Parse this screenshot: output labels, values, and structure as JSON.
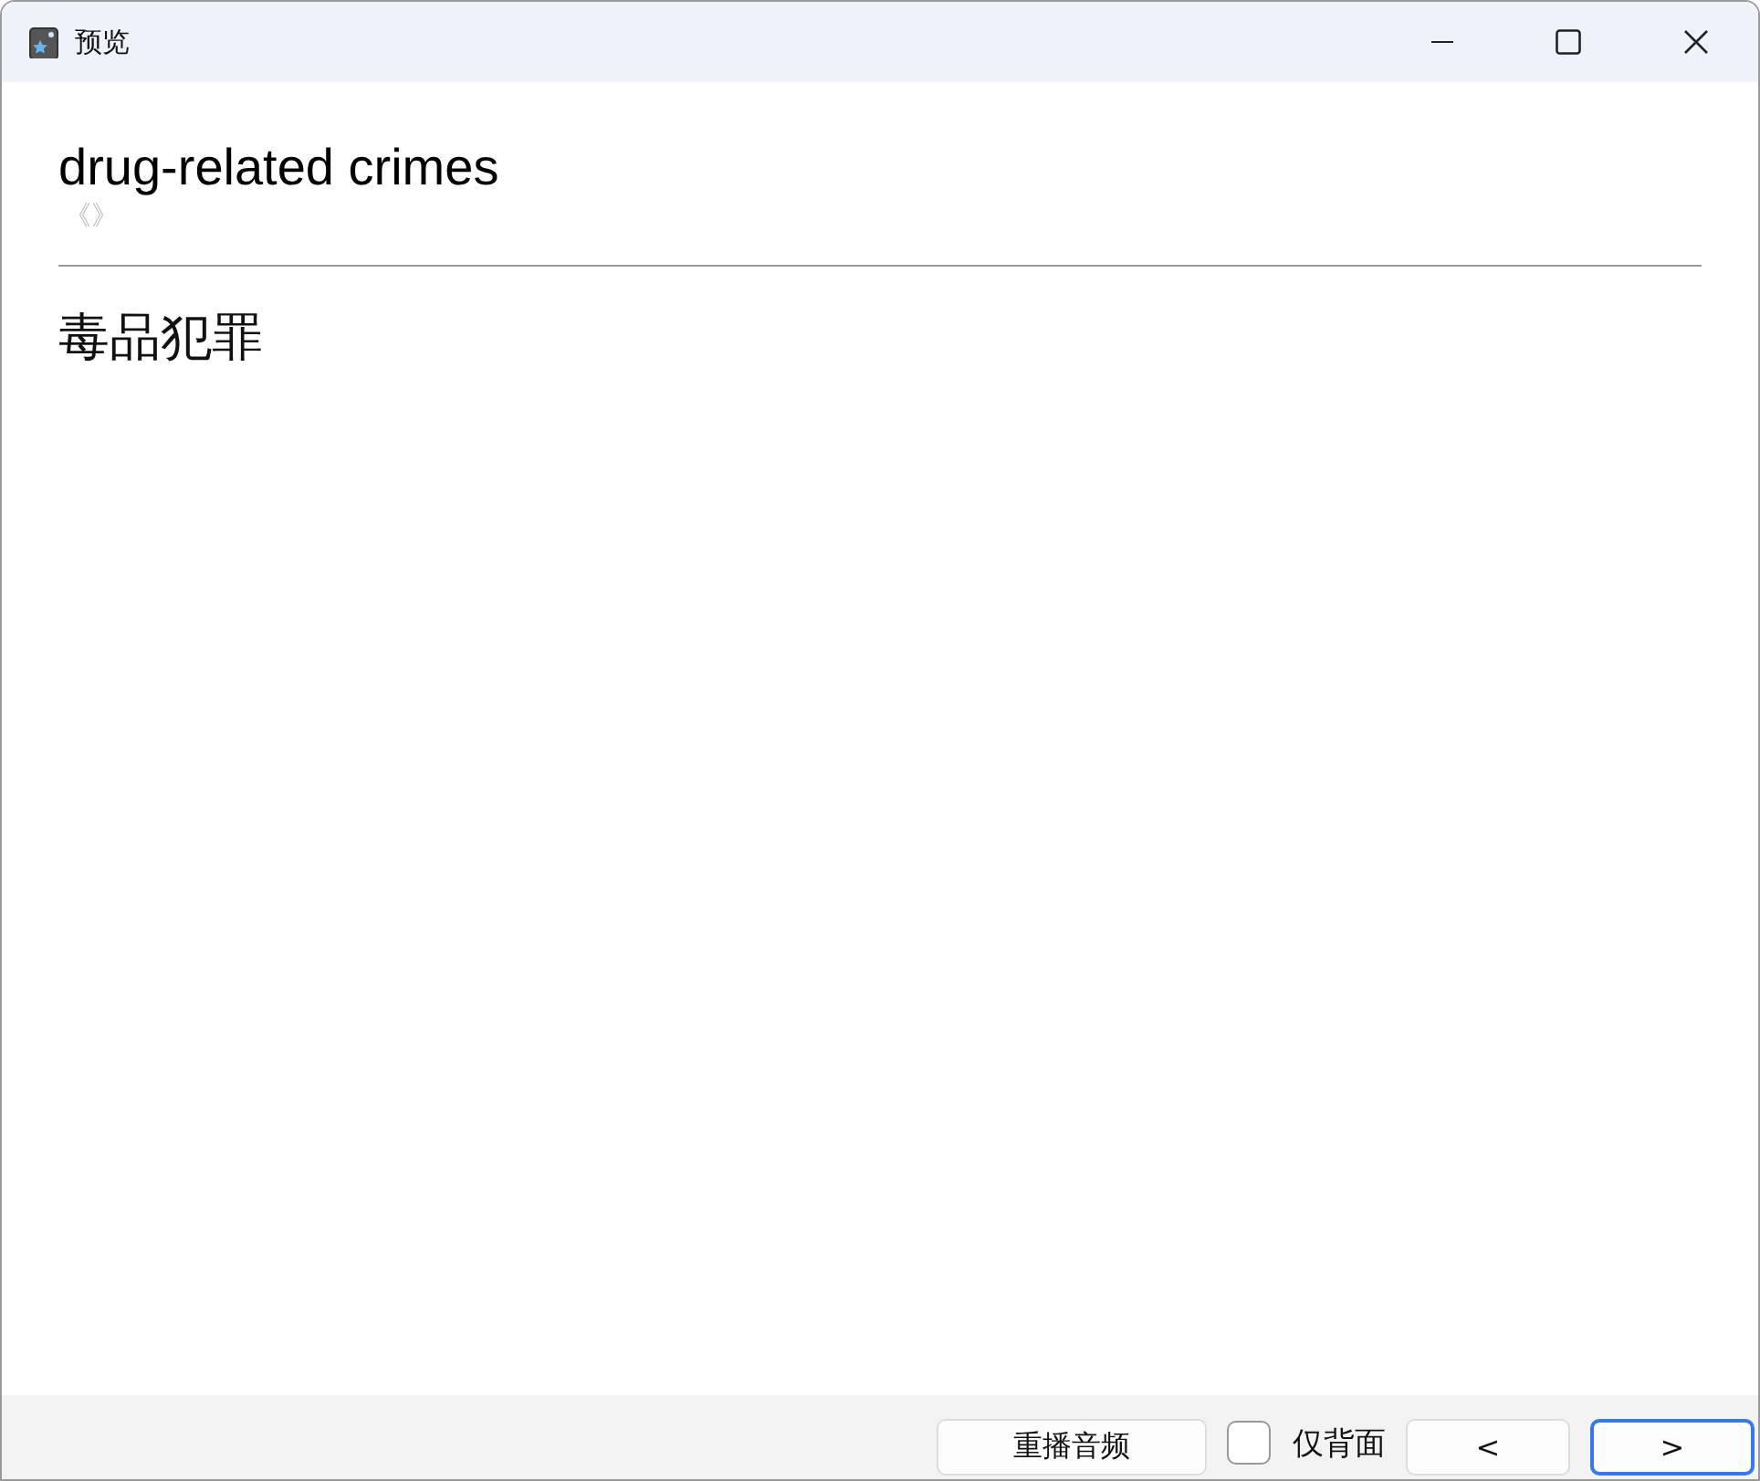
{
  "window": {
    "title": "预览"
  },
  "card": {
    "term": "drug-related crimes",
    "phonetic": "《》",
    "translation": "毒品犯罪"
  },
  "bottom_bar": {
    "replay_button": "重播音频",
    "back_only": {
      "label": "仅背面",
      "checked": false
    },
    "buttons": [
      {
        "label": "<",
        "focused": false
      },
      {
        "label": ">",
        "focused": true
      }
    ]
  }
}
